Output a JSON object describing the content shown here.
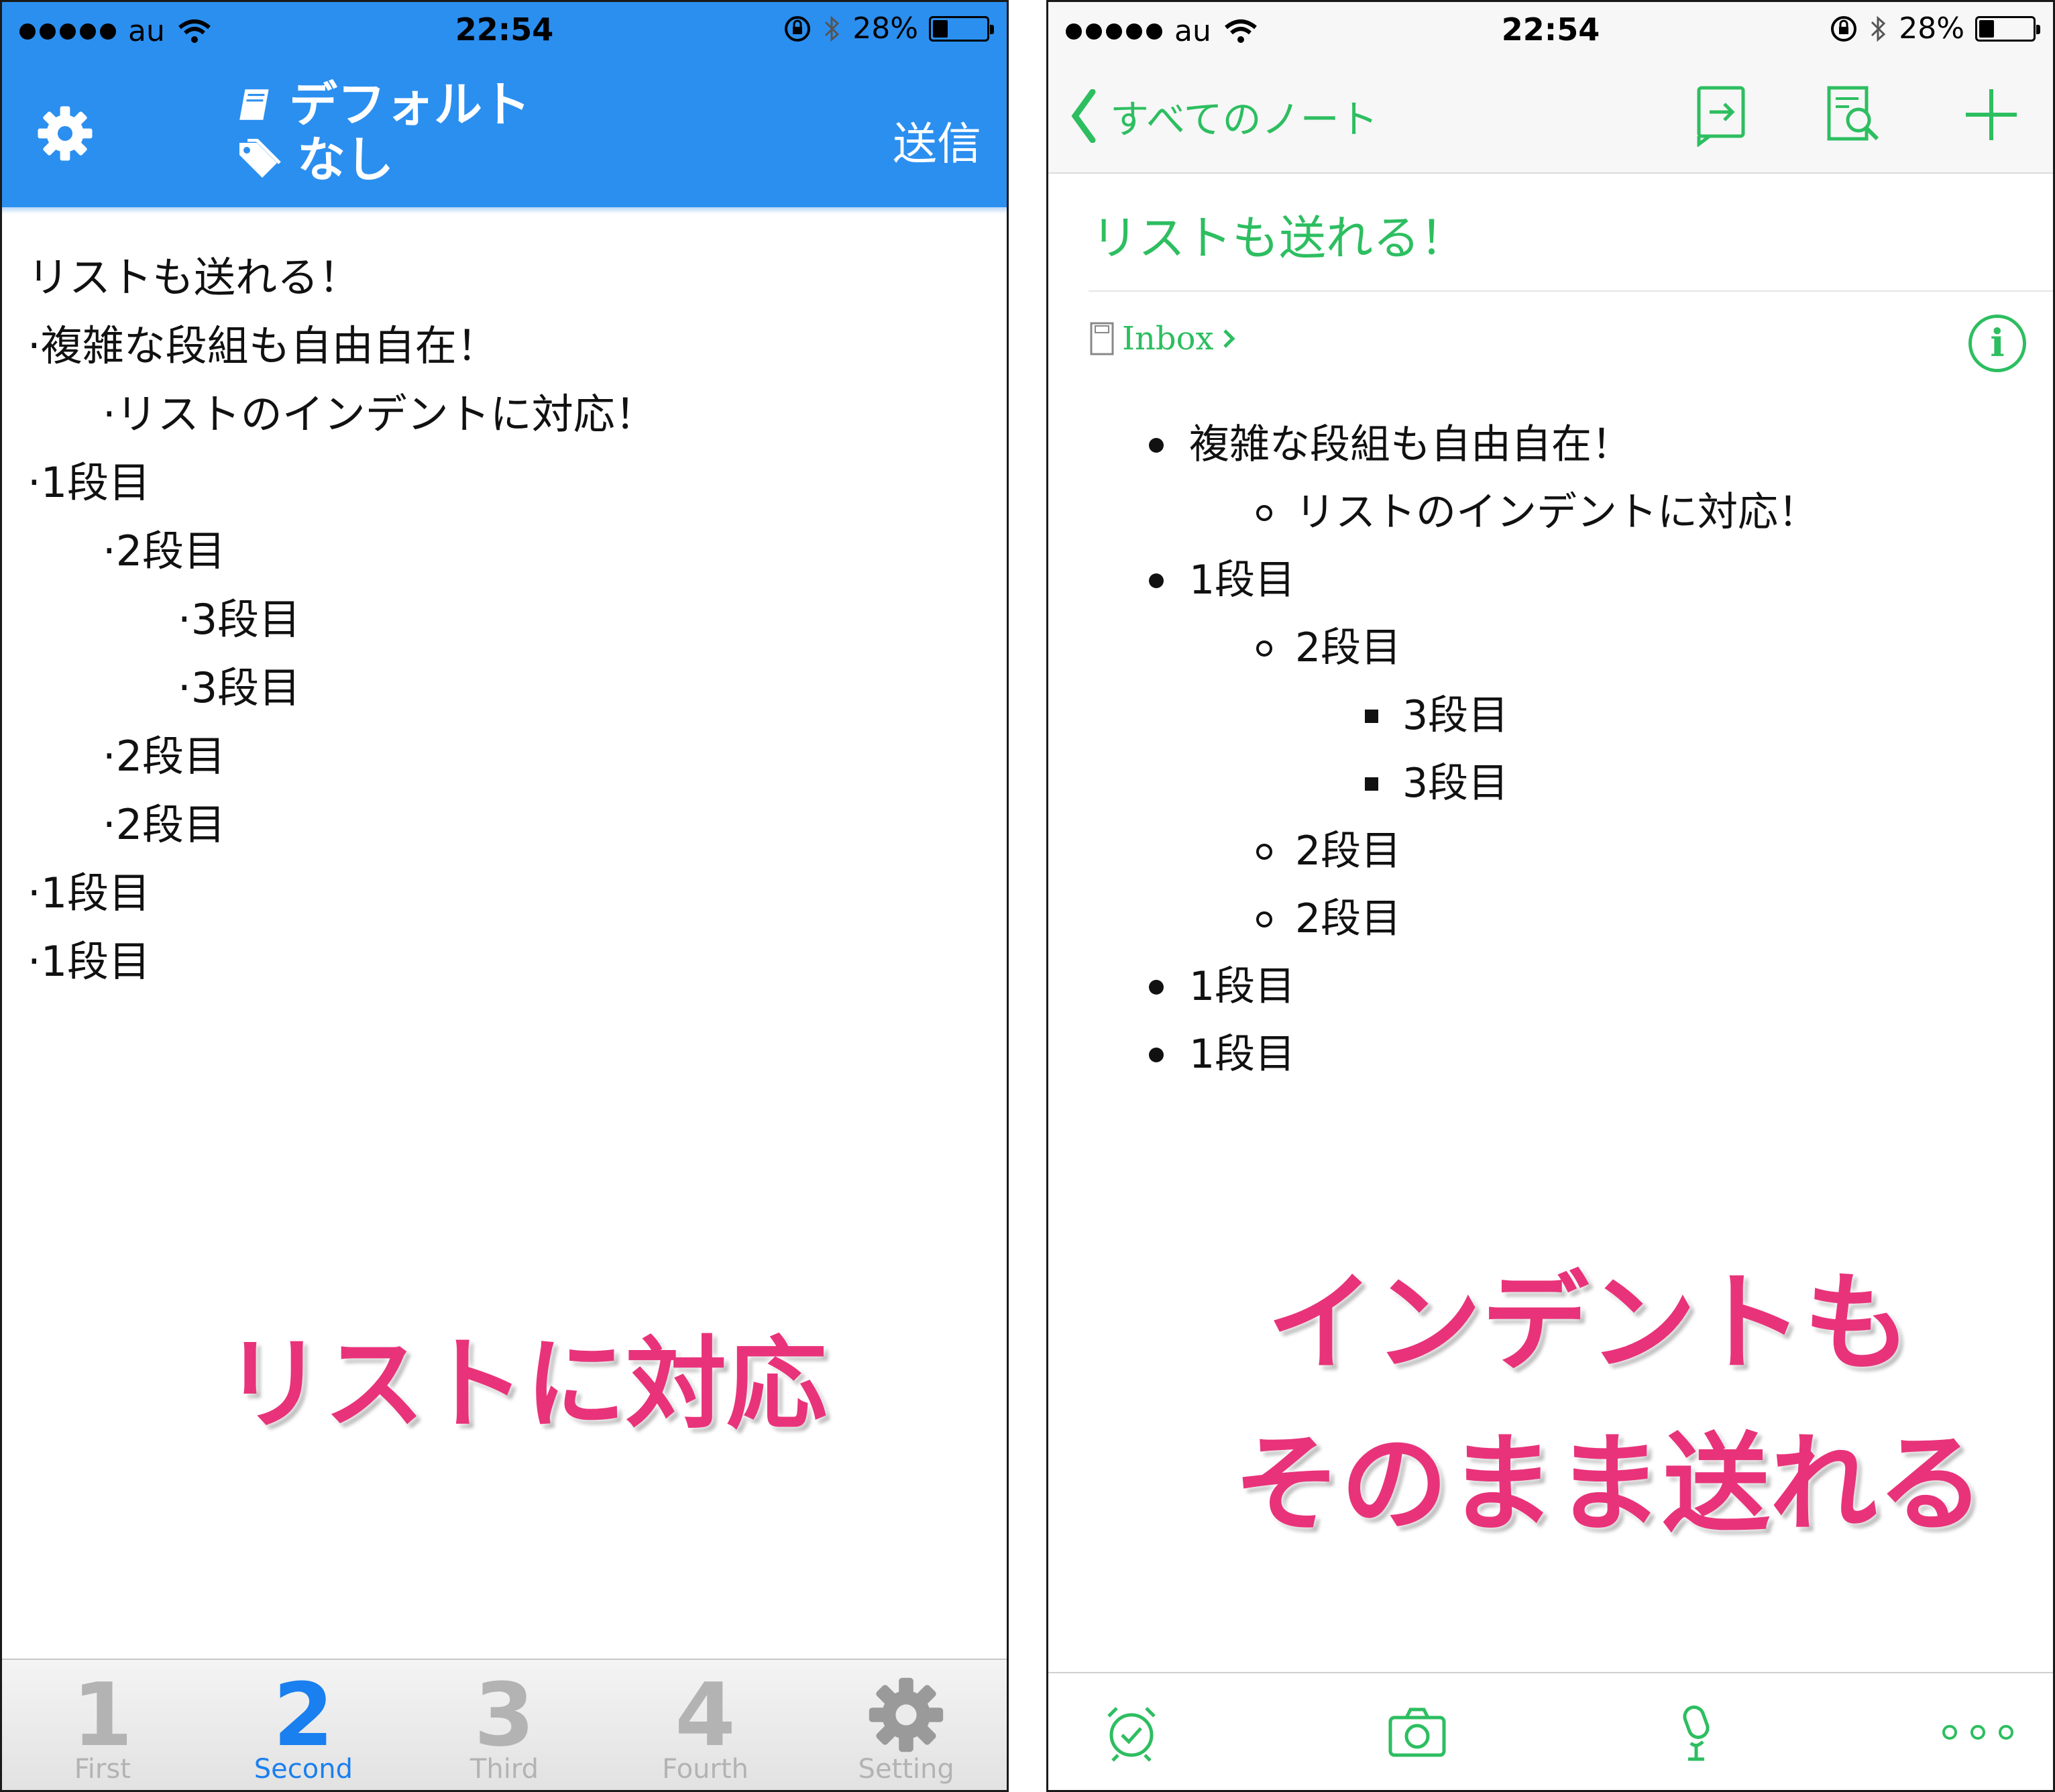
{
  "status_bar": {
    "carrier": "au",
    "time": "22:54",
    "battery_percent": "28%",
    "battery_level": 0.28
  },
  "left_app": {
    "header": {
      "notebook_label": "デフォルト",
      "tag_label": "なし",
      "send_label": "送信",
      "color": "#2b8ff0"
    },
    "lines": [
      {
        "text": "リストも送れる！",
        "indent": 0
      },
      {
        "text": "·複雑な段組も自由自在！",
        "indent": 0
      },
      {
        "text": "·リストのインデントに対応！",
        "indent": 1
      },
      {
        "text": "·1段目",
        "indent": 0
      },
      {
        "text": "·2段目",
        "indent": 1
      },
      {
        "text": "·3段目",
        "indent": 2
      },
      {
        "text": "·3段目",
        "indent": 2
      },
      {
        "text": "·2段目",
        "indent": 1
      },
      {
        "text": "·2段目",
        "indent": 1
      },
      {
        "text": "·1段目",
        "indent": 0
      },
      {
        "text": "·1段目",
        "indent": 0
      }
    ],
    "overlay": "リストに対応",
    "tabs": [
      {
        "number": "1",
        "label": "First",
        "active": false
      },
      {
        "number": "2",
        "label": "Second",
        "active": true
      },
      {
        "number": "3",
        "label": "Third",
        "active": false
      },
      {
        "number": "4",
        "label": "Fourth",
        "active": false
      },
      {
        "number": "",
        "label": "Setting",
        "active": false,
        "icon": "gear-icon"
      }
    ]
  },
  "right_app": {
    "header": {
      "back_label": "すべてのノート",
      "accent": "#2dbe60"
    },
    "note_title": "リストも送れる！",
    "notebook": "Inbox",
    "items": [
      {
        "text": "複雑な段組も自由自在！",
        "level": 1
      },
      {
        "text": "リストのインデントに対応！",
        "level": 2
      },
      {
        "text": "1段目",
        "level": 1
      },
      {
        "text": "2段目",
        "level": 2
      },
      {
        "text": "3段目",
        "level": 3
      },
      {
        "text": "3段目",
        "level": 3
      },
      {
        "text": "2段目",
        "level": 2
      },
      {
        "text": "2段目",
        "level": 2
      },
      {
        "text": "1段目",
        "level": 1
      },
      {
        "text": "1段目",
        "level": 1
      }
    ],
    "overlay_line1": "インデントも",
    "overlay_line2": "そのまま送れる",
    "toolbar_icons": [
      "alarm-clock-icon",
      "camera-icon",
      "microphone-icon",
      "more-icon"
    ]
  }
}
